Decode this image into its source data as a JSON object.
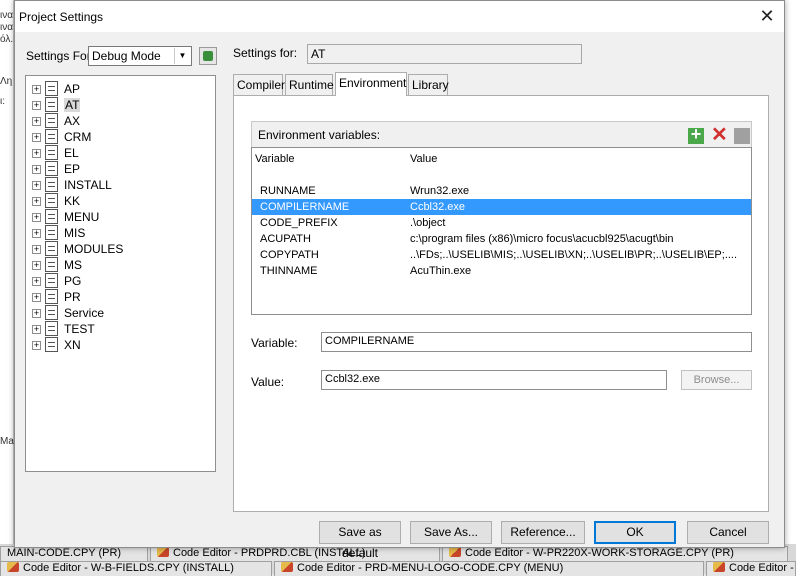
{
  "background": {
    "left_fragments": [
      "ινα",
      "ινα",
      "όλ.Γ",
      "Λη",
      "ι:",
      "Ma"
    ],
    "tabs_row1": [
      "MAIN-CODE.CPY (PR)",
      "Code Editor - PRDPRD.CBL (INSTALL)",
      "Code Editor - W-PR220X-WORK-STORAGE.CPY (PR)"
    ],
    "tabs_row2": [
      "Code Editor - W-B-FIELDS.CPY (INSTALL)",
      "Code Editor - PRD-MENU-LOGO-CODE.CPY (MENU)",
      "Code Editor - D"
    ]
  },
  "dialog": {
    "title": "Project Settings",
    "close_glyph": "✕",
    "settings_for_label": "Settings For:",
    "mode_value": "Debug Mode",
    "settings_for_project_label": "Settings for:",
    "settings_for_project_value": "AT",
    "tree": [
      {
        "label": "AP"
      },
      {
        "label": "AT",
        "selected": true
      },
      {
        "label": "AX"
      },
      {
        "label": "CRM"
      },
      {
        "label": "EL"
      },
      {
        "label": "EP"
      },
      {
        "label": "INSTALL"
      },
      {
        "label": "KK"
      },
      {
        "label": "MENU"
      },
      {
        "label": "MIS"
      },
      {
        "label": "MODULES"
      },
      {
        "label": "MS"
      },
      {
        "label": "PG"
      },
      {
        "label": "PR"
      },
      {
        "label": "Service"
      },
      {
        "label": "TEST"
      },
      {
        "label": "XN"
      }
    ],
    "tabs": [
      "Compiler",
      "Runtime",
      "Environment",
      "Library"
    ],
    "active_tab": "Environment",
    "env_header": "Environment variables:",
    "env_columns": [
      "Variable",
      "Value"
    ],
    "env_rows": [
      {
        "variable": "RUNNAME",
        "value": "Wrun32.exe"
      },
      {
        "variable": "COMPILERNAME",
        "value": "Ccbl32.exe",
        "selected": true
      },
      {
        "variable": "CODE_PREFIX",
        "value": ".\\object"
      },
      {
        "variable": "ACUPATH",
        "value": "c:\\program files (x86)\\micro focus\\acucbl925\\acugt\\bin"
      },
      {
        "variable": "COPYPATH",
        "value": "..\\FDs;..\\USELIB\\MIS;..\\USELIB\\XN;..\\USELIB\\PR;..\\USELIB\\EP;...."
      },
      {
        "variable": "THINNAME",
        "value": "AcuThin.exe"
      }
    ],
    "variable_label": "Variable:",
    "variable_value": "COMPILERNAME",
    "value_label": "Value:",
    "value_value": "Ccbl32.exe",
    "browse_label": "Browse...",
    "buttons": {
      "save_default": "Save as default",
      "save_as": "Save As...",
      "reference": "Reference...",
      "ok": "OK",
      "cancel": "Cancel"
    }
  }
}
